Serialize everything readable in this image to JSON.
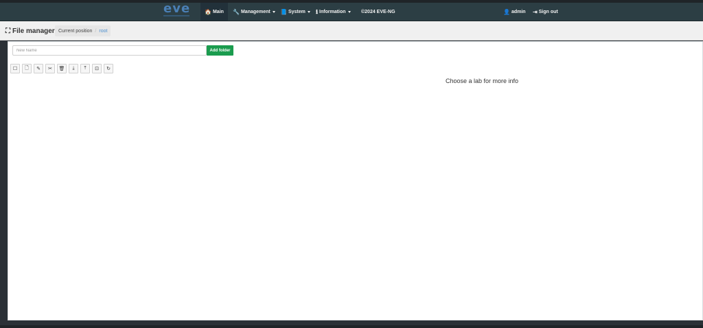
{
  "navbar": {
    "logo_text": "eve",
    "items": [
      {
        "label": "Main",
        "icon": "home-icon",
        "glyph": "🏠"
      },
      {
        "label": "Management",
        "icon": "wrench-icon",
        "glyph": "🔧"
      },
      {
        "label": "System",
        "icon": "book-icon",
        "glyph": "📘"
      },
      {
        "label": "Information",
        "icon": "info-icon",
        "glyph": "ℹ"
      },
      {
        "label": "©2024 EVE-NG"
      }
    ],
    "user": {
      "label": "admin",
      "glyph": "👤"
    },
    "signout": {
      "label": "Sign out",
      "glyph": "⇥"
    }
  },
  "header": {
    "title": "File manager",
    "title_glyph": "⛶",
    "breadcrumb": {
      "current": "Current position",
      "separator": "/",
      "root": "root"
    }
  },
  "main": {
    "new_name_placeholder": "New Name",
    "add_folder_label": "Add folder",
    "toolbar": [
      {
        "name": "select-all-checkbox",
        "glyph": "☐"
      },
      {
        "name": "new-file-icon",
        "glyph": "🗋"
      },
      {
        "name": "edit-icon",
        "glyph": "✎"
      },
      {
        "name": "cut-icon",
        "glyph": "✂"
      },
      {
        "name": "delete-icon",
        "glyph": "🗑"
      },
      {
        "name": "import-icon",
        "glyph": "⤓"
      },
      {
        "name": "export-icon",
        "glyph": "⤒"
      },
      {
        "name": "move-icon",
        "glyph": "⊡"
      },
      {
        "name": "refresh-icon",
        "glyph": "↻"
      }
    ],
    "info_text": "Choose a lab for more info"
  },
  "colors": {
    "navbar_bg": "#2c3e44",
    "accent_green": "#1a9c4e",
    "link_blue": "#4a8fd0"
  }
}
